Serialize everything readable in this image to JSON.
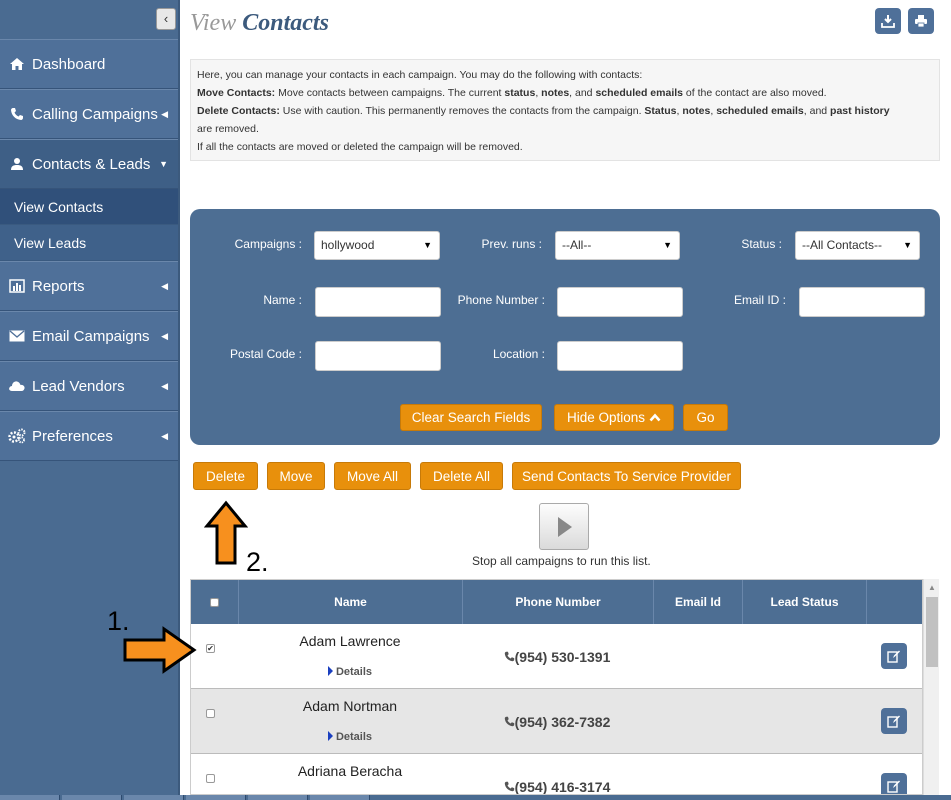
{
  "sidebar": {
    "items": [
      {
        "label": "Dashboard",
        "icon": "home-icon"
      },
      {
        "label": "Calling Campaigns",
        "icon": "phone-icon"
      },
      {
        "label": "Contacts & Leads",
        "icon": "user-icon"
      },
      {
        "label": "Reports",
        "icon": "bar-chart-icon"
      },
      {
        "label": "Email Campaigns",
        "icon": "envelope-icon"
      },
      {
        "label": "Lead Vendors",
        "icon": "cloud-icon"
      },
      {
        "label": "Preferences",
        "icon": "gears-icon"
      }
    ],
    "subitems": [
      {
        "label": "View Contacts"
      },
      {
        "label": "View Leads"
      }
    ]
  },
  "header": {
    "title_view": "View",
    "title_main": "Contacts"
  },
  "info": {
    "line1": "Here, you can manage your contacts in each campaign. You may do the following with contacts:",
    "move_label": "Move Contacts:",
    "move_text_a": " Move contacts between campaigns. The current ",
    "move_b1": "status",
    "move_sep1": ", ",
    "move_b2": "notes",
    "move_sep2": ", and ",
    "move_b3": "scheduled emails",
    "move_text_c": " of the contact are also moved.",
    "delete_label": "Delete Contacts:",
    "delete_text_a": " Use with caution. This permanently removes the contacts from the campaign. ",
    "del_b1": "Status",
    "del_sep1": ", ",
    "del_b2": "notes",
    "del_sep2": ", ",
    "del_b3": "scheduled emails",
    "del_sep3": ", and ",
    "del_b4": "past history",
    "line4": "are removed.",
    "line5": "If all the contacts are moved or deleted the campaign will be removed."
  },
  "search": {
    "campaigns_label": "Campaigns :",
    "campaigns_value": "hollywood",
    "prev_runs_label": "Prev. runs :",
    "prev_runs_value": "--All--",
    "status_label": "Status :",
    "status_value": "--All Contacts--",
    "name_label": "Name :",
    "phone_label": "Phone Number :",
    "email_label": "Email ID :",
    "postal_label": "Postal Code :",
    "location_label": "Location :",
    "clear_label": "Clear Search Fields",
    "hide_label": "Hide Options",
    "go_label": "Go"
  },
  "actions": {
    "delete": "Delete",
    "move": "Move",
    "move_all": "Move All",
    "delete_all": "Delete All",
    "send": "Send Contacts To Service Provider"
  },
  "run": {
    "stop_text": "Stop all campaigns to run this list."
  },
  "table": {
    "headers": {
      "name": "Name",
      "phone": "Phone Number",
      "email": "Email Id",
      "lead_status": "Lead Status"
    },
    "details_label": "Details",
    "rows": [
      {
        "name": "Adam Lawrence",
        "phone": "(954) 530-1391",
        "checked": true
      },
      {
        "name": "Adam Nortman",
        "phone": "(954) 362-7382",
        "checked": false
      },
      {
        "name": "Adriana Beracha",
        "phone": "(954) 416-3174",
        "checked": false
      }
    ]
  },
  "annotations": {
    "step1": "1.",
    "step2": "2."
  },
  "colors": {
    "accent_orange": "#e8900c",
    "panel_blue": "#4d6e93",
    "sidebar_blue": "#4a6b91"
  }
}
